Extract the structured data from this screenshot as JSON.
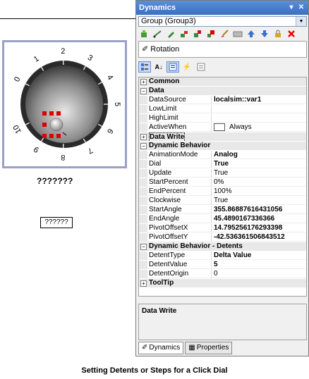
{
  "left": {
    "dial_numbers": [
      "0",
      "1",
      "2",
      "3",
      "4",
      "5",
      "6",
      "7",
      "8",
      "9",
      "10"
    ],
    "label": "???????",
    "button": "??????"
  },
  "panel": {
    "title": "Dynamics",
    "group_combo": "Group (Group3)",
    "animation_item": "Rotation",
    "description_title": "Data Write",
    "tabs": [
      "Dynamics",
      "Properties"
    ]
  },
  "grid": {
    "common": "Common",
    "data": "Data",
    "datasource": {
      "name": "DataSource",
      "value": "localsim::var1"
    },
    "lowlimit": {
      "name": "LowLimit",
      "value": ""
    },
    "highlimit": {
      "name": "HighLimit",
      "value": ""
    },
    "activewhen": {
      "name": "ActiveWhen",
      "value": "Always"
    },
    "datawrite": "Data Write",
    "dynbehavior": "Dynamic Behavior",
    "animationmode": {
      "name": "AnimationMode",
      "value": "Analog"
    },
    "dial": {
      "name": "Dial",
      "value": "True"
    },
    "update": {
      "name": "Update",
      "value": "True"
    },
    "startpercent": {
      "name": "StartPercent",
      "value": "0%"
    },
    "endpercent": {
      "name": "EndPercent",
      "value": "100%"
    },
    "clockwise": {
      "name": "Clockwise",
      "value": "True"
    },
    "startangle": {
      "name": "StartAngle",
      "value": "355.86887616431056"
    },
    "endangle": {
      "name": "EndAngle",
      "value": "45.4890167336366"
    },
    "pivotoffsetx": {
      "name": "PivotOffsetX",
      "value": "14.795256176293398"
    },
    "pivotoffsety": {
      "name": "PivotOffsetY",
      "value": "-42.536361506843512"
    },
    "detents": "Dynamic Behavior - Detents",
    "detenttype": {
      "name": "DetentType",
      "value": "Delta Value"
    },
    "detentvalue": {
      "name": "DetentValue",
      "value": "5"
    },
    "detentorigin": {
      "name": "DetentOrigin",
      "value": "0"
    },
    "tooltip": "ToolTip"
  },
  "caption": "Setting Detents or Steps for a Click Dial",
  "colors": {
    "titlebar": "#3a6fc2",
    "selection_border": "#9aa0c6",
    "handle_red": "#dd0000"
  }
}
